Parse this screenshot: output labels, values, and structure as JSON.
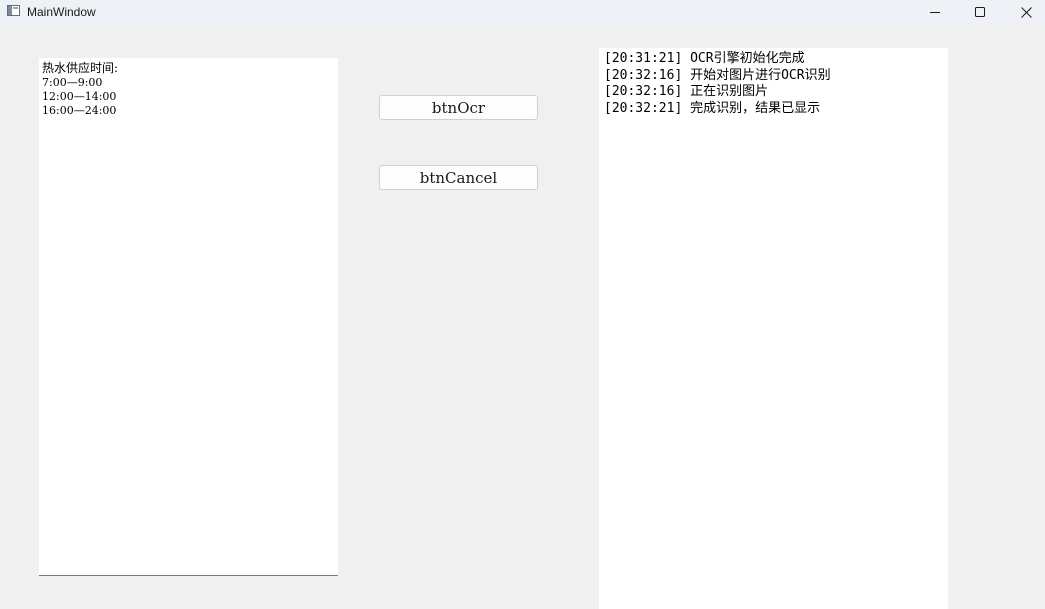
{
  "window": {
    "title": "MainWindow"
  },
  "left_panel": {
    "lines": [
      "热水供应时间:",
      "7:00—9:00",
      "12:00—14:00",
      "16:00—24:00"
    ]
  },
  "buttons": {
    "ocr_label": "btnOcr",
    "cancel_label": "btnCancel"
  },
  "log": {
    "lines": [
      "[20:31:21] OCR引擎初始化完成",
      "[20:32:16] 开始对图片进行OCR识别",
      "[20:32:16] 正在识别图片",
      "[20:32:21] 完成识别，结果已显示"
    ]
  },
  "icons": {
    "app": "app-window-icon",
    "minimize": "minimize-icon",
    "maximize": "maximize-icon",
    "close": "close-icon"
  }
}
